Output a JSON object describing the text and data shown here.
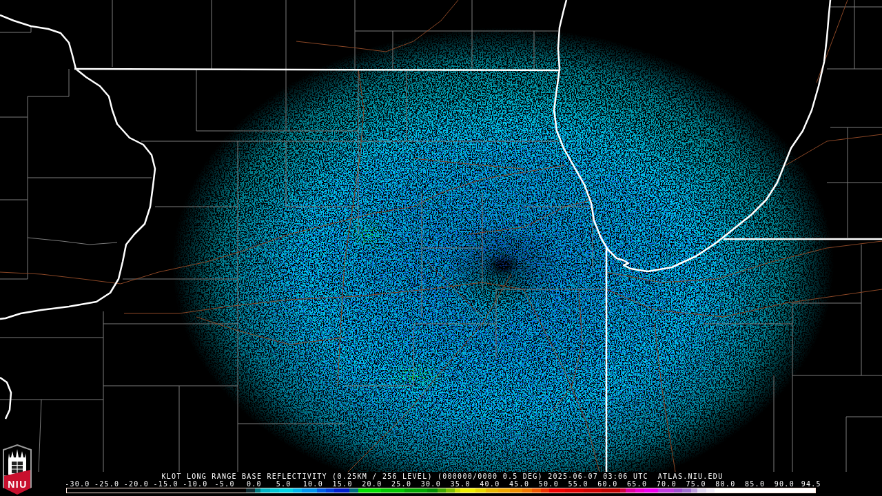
{
  "radar_map": {
    "caption": "KLOT LONG RANGE BASE REFLECTIVITY (0.25KM / 256 LEVEL) (000000/0000 0.5 DEG) 2025-06-07 03:06 UTC",
    "source": "ATLAS.NIU.EDU"
  },
  "logo": {
    "text": "NIU"
  },
  "color_scale": {
    "labels": [
      "-30.0",
      "-25.0",
      "-20.0",
      "-15.0",
      "-10.0",
      "-5.0",
      "0.0",
      "5.0",
      "10.0",
      "15.0",
      "20.0",
      "25.0",
      "30.0",
      "35.0",
      "40.0",
      "45.0",
      "50.0",
      "55.0",
      "60.0",
      "65.0",
      "70.0",
      "75.0",
      "80.0",
      "85.0",
      "90.0",
      "94.5"
    ]
  }
}
